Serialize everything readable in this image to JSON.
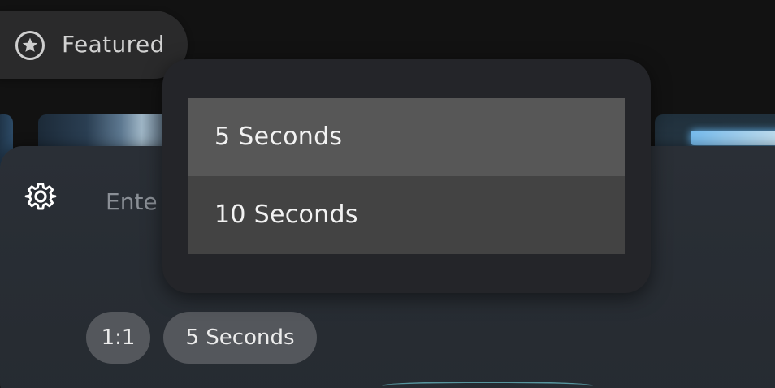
{
  "featured": {
    "label": "Featured",
    "icon": "star-circle-icon"
  },
  "prompt": {
    "placeholder": "Ente",
    "settings_icon": "gear-icon"
  },
  "chips": {
    "aspect_ratio": "1:1",
    "duration": "5 Seconds"
  },
  "duration_menu": {
    "options": [
      "5 Seconds",
      "10 Seconds"
    ],
    "highlighted": "5 Seconds"
  },
  "colors": {
    "background": "#121212",
    "panel": "#2a2f36",
    "menu": "#242529",
    "option": "#434343",
    "option_highlighted": "#575757",
    "chip": "#54575c"
  }
}
